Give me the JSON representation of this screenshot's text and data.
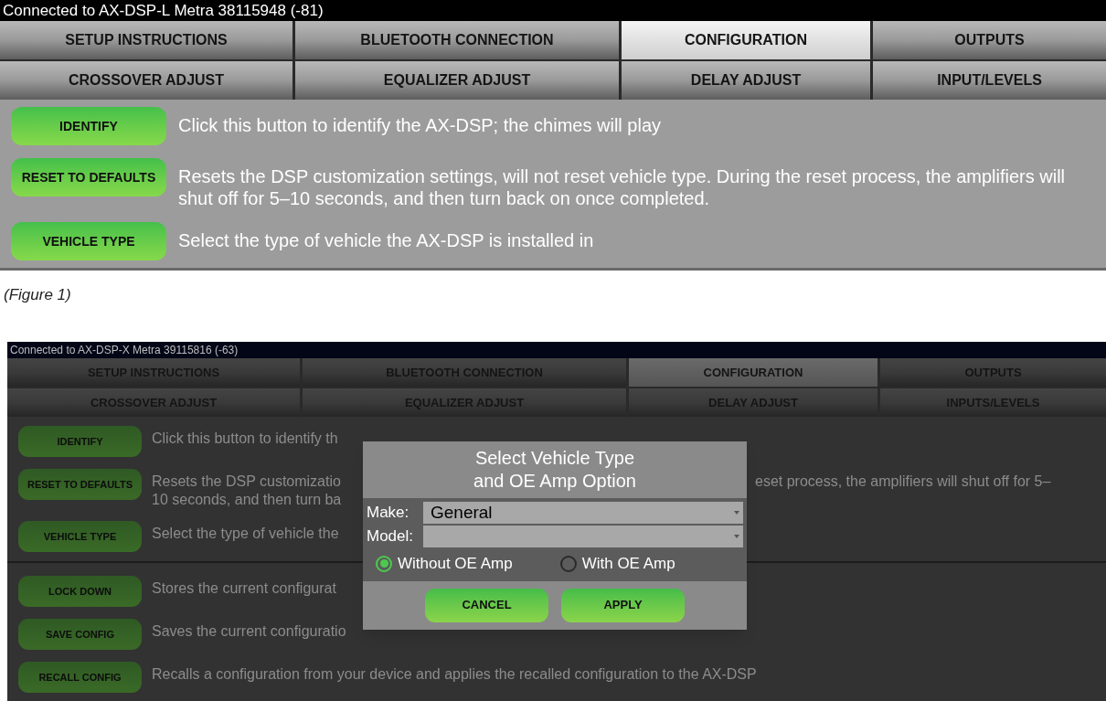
{
  "screens": [
    {
      "status": "Connected to AX-DSP-L Metra 38115948 (-81)",
      "tabs": [
        {
          "label": "SETUP INSTRUCTIONS",
          "selected": false
        },
        {
          "label": "BLUETOOTH CONNECTION",
          "selected": false
        },
        {
          "label": "CONFIGURATION",
          "selected": true
        },
        {
          "label": "OUTPUTS",
          "selected": false
        },
        {
          "label": "CROSSOVER ADJUST",
          "selected": false
        },
        {
          "label": "EQUALIZER ADJUST",
          "selected": false
        },
        {
          "label": "DELAY ADJUST",
          "selected": false
        },
        {
          "label": "INPUT/LEVELS",
          "selected": false
        }
      ],
      "row_groups": [
        [
          {
            "button": "IDENTIFY",
            "lines": [
              {
                "left": "Click this button to identify the AX-DSP; the chimes will play"
              }
            ]
          },
          {
            "button": "RESET TO DEFAULTS",
            "lines": [
              {
                "left": "Resets the DSP customization settings, will not reset vehicle type. During the reset process, the amplifiers will shut off for 5–10 seconds, and then turn back on once completed."
              }
            ]
          },
          {
            "button": "VEHICLE TYPE",
            "lines": [
              {
                "left": "Select the type of vehicle the AX-DSP is installed in"
              }
            ]
          }
        ]
      ]
    },
    {
      "status": "Connected to AX-DSP-X Metra 39115816 (-63)",
      "tabs": [
        {
          "label": "SETUP INSTRUCTIONS",
          "selected": false
        },
        {
          "label": "BLUETOOTH CONNECTION",
          "selected": false
        },
        {
          "label": "CONFIGURATION",
          "selected": true
        },
        {
          "label": "OUTPUTS",
          "selected": false
        },
        {
          "label": "CROSSOVER ADJUST",
          "selected": false
        },
        {
          "label": "EQUALIZER ADJUST",
          "selected": false
        },
        {
          "label": "DELAY ADJUST",
          "selected": false
        },
        {
          "label": "INPUTS/LEVELS",
          "selected": false
        }
      ],
      "row_groups": [
        [
          {
            "button": "IDENTIFY",
            "lines": [
              {
                "left": "Click this button to identify th"
              }
            ]
          },
          {
            "button": "RESET TO DEFAULTS",
            "lines": [
              {
                "left": "Resets the DSP customizatio",
                "right": "eset process, the amplifiers will shut off for 5–"
              },
              {
                "left": "10 seconds, and then turn ba"
              }
            ]
          },
          {
            "button": "VEHICLE TYPE",
            "lines": [
              {
                "left": "Select the type of vehicle the"
              }
            ]
          }
        ],
        [
          {
            "button": "LOCK DOWN",
            "lines": [
              {
                "left": "Stores the current configurat"
              }
            ]
          },
          {
            "button": "SAVE CONFIG",
            "lines": [
              {
                "left": "Saves the current configuratio"
              }
            ]
          },
          {
            "button": "RECALL CONFIG",
            "lines": [
              {
                "left": "Recalls a configuration from your device and applies the recalled configuration to the AX-DSP"
              }
            ]
          }
        ]
      ],
      "dialog": {
        "title_lines": [
          "Select Vehicle Type",
          "and OE Amp Option"
        ],
        "fields": [
          {
            "label": "Make:",
            "value": "General"
          },
          {
            "label": "Model:"
          }
        ],
        "options": [
          {
            "label": "Without OE Amp",
            "selected": true
          },
          {
            "label": "With OE Amp",
            "selected": false
          }
        ],
        "buttons": [
          "CANCEL",
          "APPLY"
        ]
      }
    }
  ],
  "figure_caption": "(Figure 1)"
}
